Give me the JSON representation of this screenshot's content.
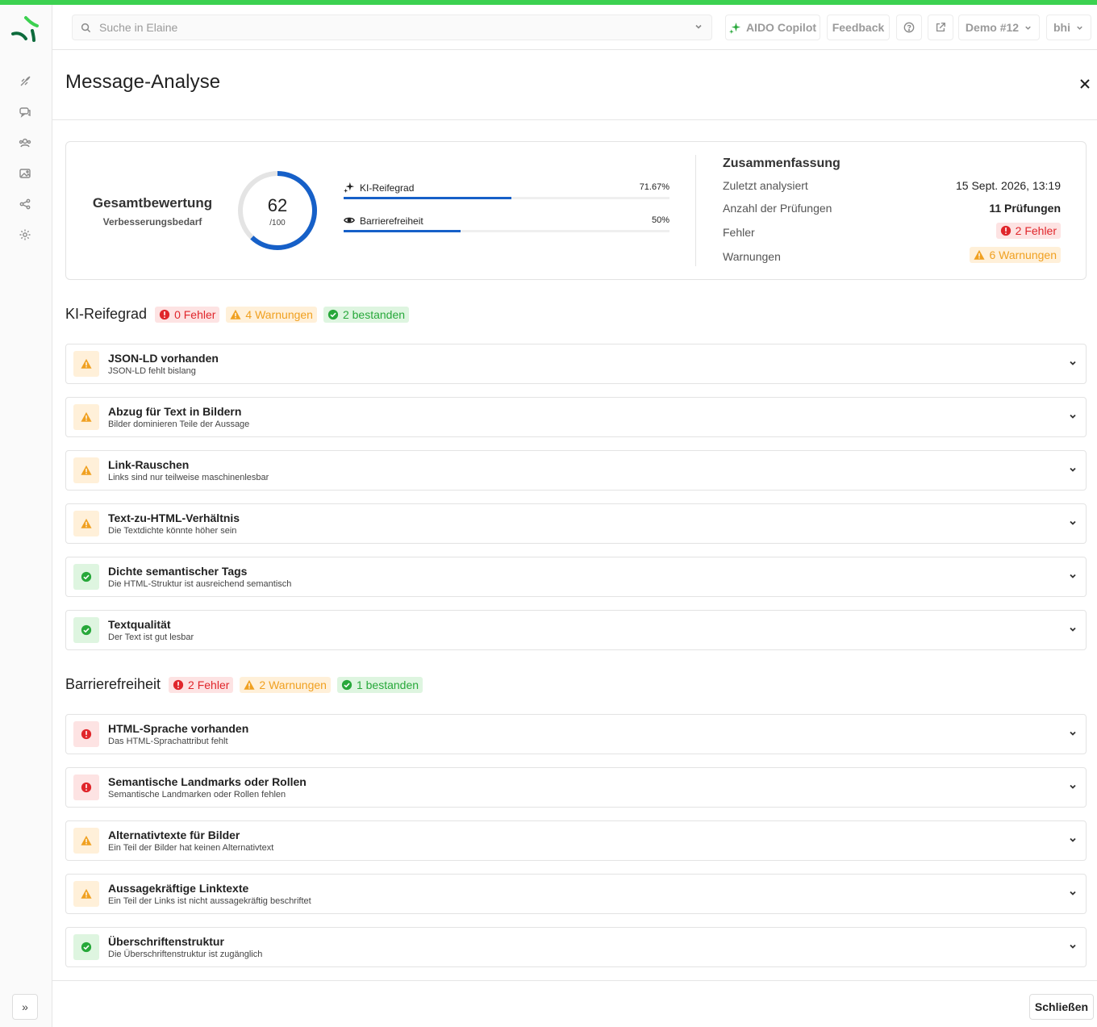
{
  "topbar": {
    "search_placeholder": "Suche in Elaine",
    "copilot_label": "AIDO Copilot",
    "feedback_label": "Feedback",
    "workspace_label": "Demo #12",
    "user_label": "bhi"
  },
  "modal": {
    "title": "Message-Analyse",
    "close_button_label": "Schließen"
  },
  "overview": {
    "title": "Gesamtbewertung",
    "subtitle": "Verbesserungsbedarf",
    "score": "62",
    "score_max": "/100",
    "score_value": 62,
    "metrics": [
      {
        "label": "KI-Reifegrad",
        "percent_text": "71.67%",
        "percent": 71.67
      },
      {
        "label": "Barrierefreiheit",
        "percent_text": "50%",
        "percent": 50
      }
    ]
  },
  "summary": {
    "title": "Zusammenfassung",
    "rows": [
      {
        "key": "Zuletzt analysiert",
        "value": "15 Sept. 2026, 13:19"
      },
      {
        "key": "Anzahl der Prüfungen",
        "value": "11 Prüfungen"
      },
      {
        "key": "Fehler",
        "value": "2 Fehler"
      },
      {
        "key": "Warnungen",
        "value": "6 Warnungen"
      }
    ]
  },
  "sections": [
    {
      "title": "KI-Reifegrad",
      "errors": "0 Fehler",
      "warnings": "4 Warnungen",
      "passed": "2 bestanden",
      "items": [
        {
          "status": "warning",
          "title": "JSON-LD vorhanden",
          "desc": "JSON-LD fehlt bislang"
        },
        {
          "status": "warning",
          "title": "Abzug für Text in Bildern",
          "desc": "Bilder dominieren Teile der Aussage"
        },
        {
          "status": "warning",
          "title": "Link-Rauschen",
          "desc": "Links sind nur teilweise maschinenlesbar"
        },
        {
          "status": "warning",
          "title": "Text-zu-HTML-Verhältnis",
          "desc": "Die Textdichte könnte höher sein"
        },
        {
          "status": "passed",
          "title": "Dichte semantischer Tags",
          "desc": "Die HTML-Struktur ist ausreichend semantisch"
        },
        {
          "status": "passed",
          "title": "Textqualität",
          "desc": "Der Text ist gut lesbar"
        }
      ]
    },
    {
      "title": "Barrierefreiheit",
      "errors": "2 Fehler",
      "warnings": "2 Warnungen",
      "passed": "1 bestanden",
      "items": [
        {
          "status": "error",
          "title": "HTML-Sprache vorhanden",
          "desc": "Das HTML-Sprachattribut fehlt"
        },
        {
          "status": "error",
          "title": "Semantische Landmarks oder Rollen",
          "desc": "Semantische Landmarken oder Rollen fehlen"
        },
        {
          "status": "warning",
          "title": "Alternativtexte für Bilder",
          "desc": "Ein Teil der Bilder hat keinen Alternativtext"
        },
        {
          "status": "warning",
          "title": "Aussagekräftige Linktexte",
          "desc": "Ein Teil der Links ist nicht aussagekräftig beschriftet"
        },
        {
          "status": "passed",
          "title": "Überschriftenstruktur",
          "desc": "Die Überschriftenstruktur ist zugänglich"
        }
      ]
    }
  ],
  "colors": {
    "brand_green": "#3cd150",
    "progress_blue": "#1660c8",
    "error_red": "#e0262b",
    "warning_orange": "#f0a020",
    "success_green": "#27a83a"
  },
  "icons": {
    "sidebar": [
      "rocket-icon",
      "chat-icon",
      "audience-icon",
      "image-icon",
      "share-icon",
      "settings-icon"
    ]
  }
}
